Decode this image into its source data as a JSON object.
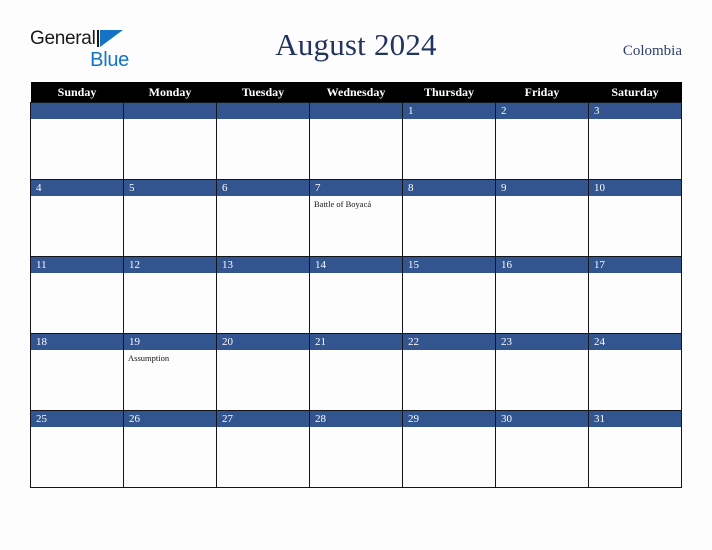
{
  "brand": {
    "name_part1": "General",
    "name_part2": "Blue",
    "mark": "triangle-logo"
  },
  "header": {
    "title": "August 2024",
    "region": "Colombia"
  },
  "colors": {
    "accent_blue": "#32548f",
    "logo_blue": "#1473c4",
    "title_navy": "#22355e",
    "header_bar": "#000000",
    "page_background": "#fdfdfd",
    "cell_border": "#12161c"
  },
  "calendar": {
    "weekday_headers": [
      "Sunday",
      "Monday",
      "Tuesday",
      "Wednesday",
      "Thursday",
      "Friday",
      "Saturday"
    ],
    "weeks": [
      [
        {
          "day": "",
          "events": []
        },
        {
          "day": "",
          "events": []
        },
        {
          "day": "",
          "events": []
        },
        {
          "day": "",
          "events": []
        },
        {
          "day": "1",
          "events": []
        },
        {
          "day": "2",
          "events": []
        },
        {
          "day": "3",
          "events": []
        }
      ],
      [
        {
          "day": "4",
          "events": []
        },
        {
          "day": "5",
          "events": []
        },
        {
          "day": "6",
          "events": []
        },
        {
          "day": "7",
          "events": [
            "Battle of Boyacá"
          ]
        },
        {
          "day": "8",
          "events": []
        },
        {
          "day": "9",
          "events": []
        },
        {
          "day": "10",
          "events": []
        }
      ],
      [
        {
          "day": "11",
          "events": []
        },
        {
          "day": "12",
          "events": []
        },
        {
          "day": "13",
          "events": []
        },
        {
          "day": "14",
          "events": []
        },
        {
          "day": "15",
          "events": []
        },
        {
          "day": "16",
          "events": []
        },
        {
          "day": "17",
          "events": []
        }
      ],
      [
        {
          "day": "18",
          "events": []
        },
        {
          "day": "19",
          "events": [
            "Assumption"
          ]
        },
        {
          "day": "20",
          "events": []
        },
        {
          "day": "21",
          "events": []
        },
        {
          "day": "22",
          "events": []
        },
        {
          "day": "23",
          "events": []
        },
        {
          "day": "24",
          "events": []
        }
      ],
      [
        {
          "day": "25",
          "events": []
        },
        {
          "day": "26",
          "events": []
        },
        {
          "day": "27",
          "events": []
        },
        {
          "day": "28",
          "events": []
        },
        {
          "day": "29",
          "events": []
        },
        {
          "day": "30",
          "events": []
        },
        {
          "day": "31",
          "events": []
        }
      ]
    ]
  }
}
